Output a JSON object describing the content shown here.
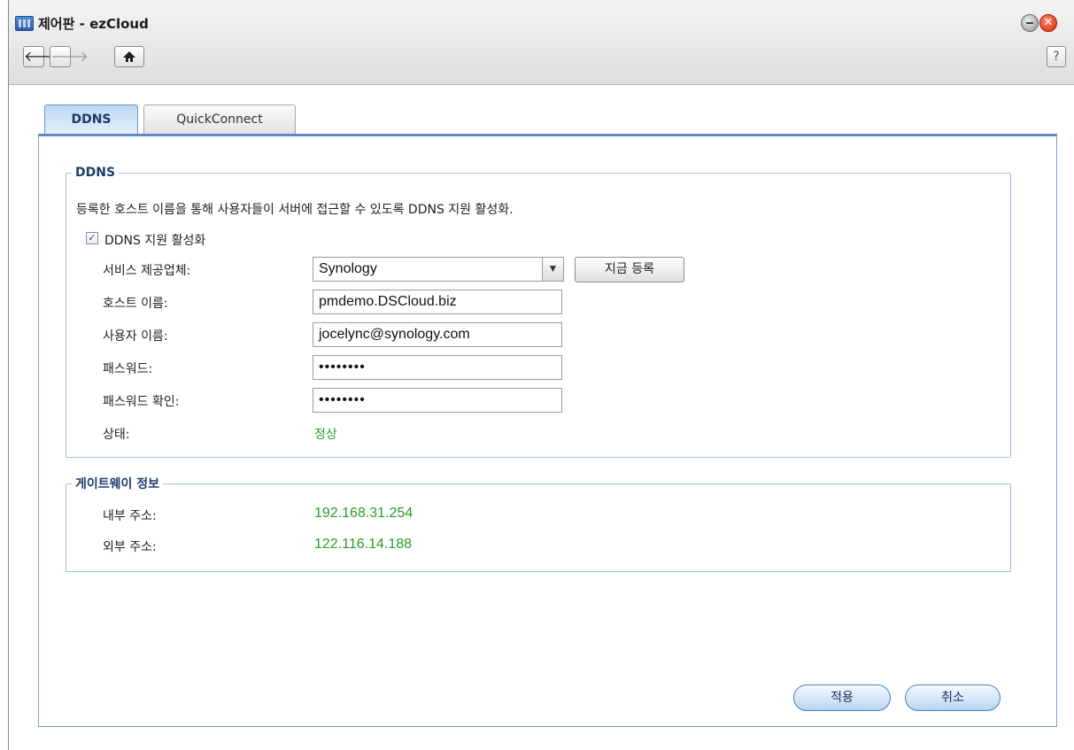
{
  "window": {
    "title": "제어판 - ezCloud",
    "close_glyph": "✕",
    "help_label": "?"
  },
  "toolbar": {
    "back_icon": "arrow-left-icon",
    "forward_icon": "arrow-right-icon",
    "home_icon": "home-icon",
    "back_glyph": "🡐",
    "forward_glyph": "🡒"
  },
  "tabs": [
    {
      "label": "DDNS",
      "active": true
    },
    {
      "label": "QuickConnect",
      "active": false
    }
  ],
  "ddns": {
    "legend": "DDNS",
    "description": "등록한 호스트 이름을 통해 사용자들이 서버에 접근할 수 있도록 DDNS 지원 활성화.",
    "enable_label": "DDNS 지원 활성화",
    "enable_checked": true,
    "check_glyph": "✓",
    "provider_label": "서비스 제공업체:",
    "provider_value": "Synology",
    "register_button": "지금 등록",
    "hostname_label": "호스트 이름:",
    "hostname_value": "pmdemo.DSCloud.biz",
    "username_label": "사용자 이름:",
    "username_value": "jocelync@synology.com",
    "password_label": "패스워드:",
    "password_value": "••••••••",
    "confirm_label": "패스워드 확인:",
    "confirm_value": "••••••••",
    "status_label": "상태:",
    "status_value": "정상"
  },
  "gateway": {
    "legend": "게이트웨이 정보",
    "internal_label": "내부 주소:",
    "internal_value": "192.168.31.254",
    "external_label": "외부 주소:",
    "external_value": "122.116.14.188"
  },
  "actions": {
    "apply": "적용",
    "cancel": "취소"
  },
  "colors": {
    "accent": "#5f8cc0",
    "status_ok": "#2a9a2a",
    "close_button": "#d8240e"
  }
}
